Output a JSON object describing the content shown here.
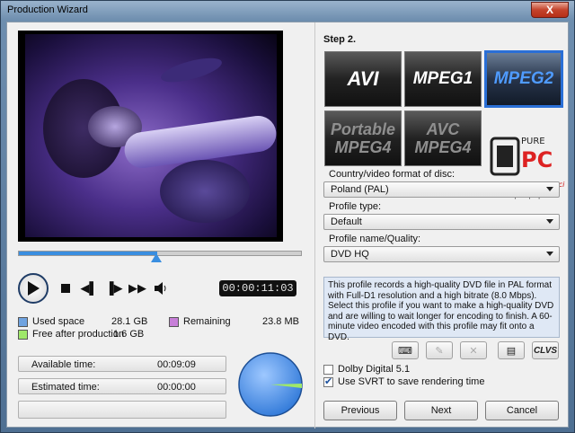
{
  "window": {
    "title": "Production Wizard",
    "close_label": "X"
  },
  "player": {
    "timecode": "00:00:11:03",
    "progress": 0.49
  },
  "disk": {
    "used_label": "Used space",
    "used_value": "28.1  GB",
    "remaining_label": "Remaining",
    "remaining_value": "23.8  MB",
    "free_label": "Free after production",
    "free_value": "1.6  GB",
    "colors": {
      "used": "#6fa3e0",
      "remaining": "#c77fd8",
      "free": "#9fe86a"
    }
  },
  "times": {
    "available_label": "Available time:",
    "available_value": "00:09:09",
    "estimated_label": "Estimated time:",
    "estimated_value": "00:00:00"
  },
  "right": {
    "step": "Step 2.",
    "formats": [
      "AVI",
      "MPEG1",
      "MPEG2",
      "Portable MPEG4",
      "AVC MPEG4"
    ],
    "selected_format": "MPEG2",
    "country_label": "Country/video format of disc:",
    "country_value": "Poland (PAL)",
    "profile_type_label": "Profile type:",
    "profile_type_value": "Default",
    "profile_name_label": "Profile name/Quality:",
    "profile_name_value": "DVD HQ",
    "description": "This profile records a high-quality DVD file in PAL format with Full-D1 resolution and a high bitrate (8.0 Mbps). Select this profile if you want to make a high-quality DVD and are willing to wait longer for encoding to finish. A 60-minute video encoded with this profile may fit onto a DVD.",
    "toolbar": {
      "clvs": "CLVS"
    },
    "dolby_label": "Dolby Digital 5.1",
    "dolby_checked": false,
    "svrt_label": "Use SVRT to save rendering time",
    "svrt_checked": true,
    "buttons": {
      "previous": "Previous",
      "next": "Next",
      "cancel": "Cancel"
    }
  },
  "watermark": {
    "brand": "PUREPC",
    "slogan": "Witamy, co się kręci",
    "url": "www.purepc.pl"
  }
}
